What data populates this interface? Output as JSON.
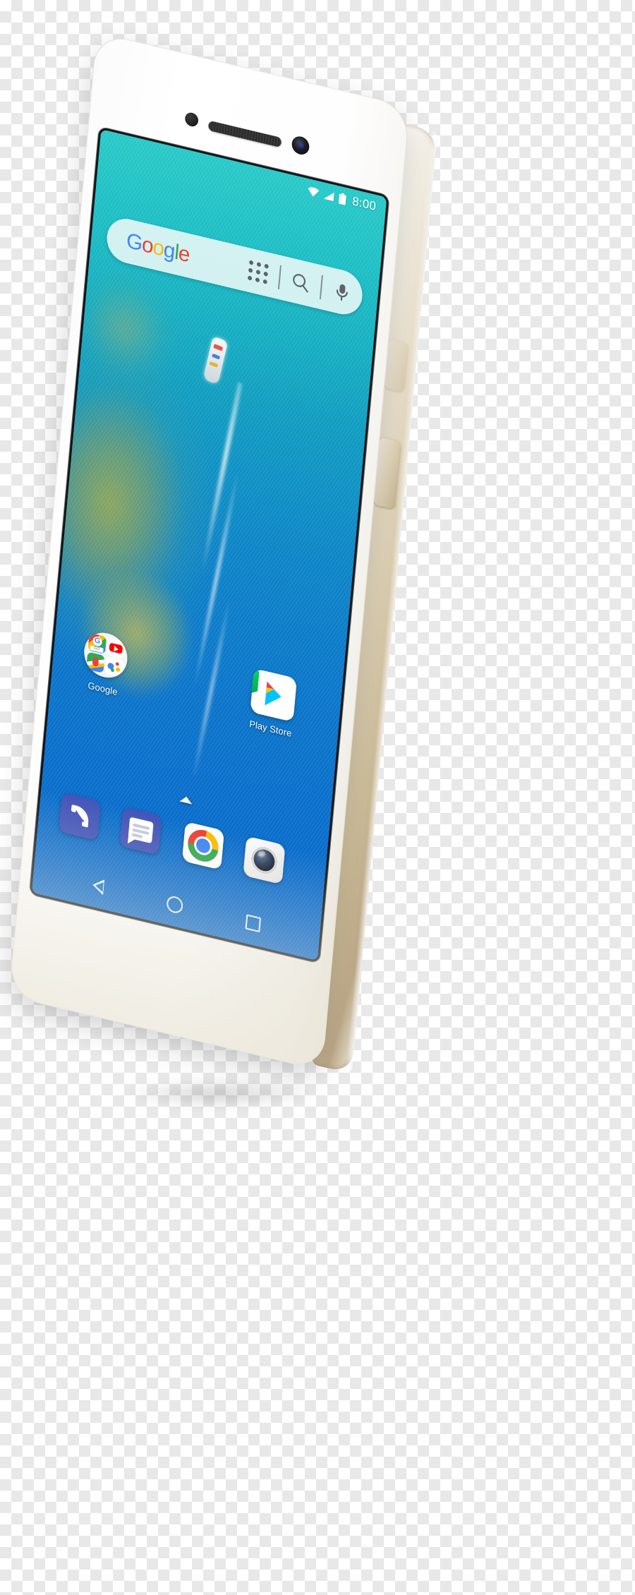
{
  "scene": {
    "subject": "smartphone-product-photo",
    "device_color": "#efe8da",
    "device_accent": "#d9cbad"
  },
  "status_bar": {
    "time": "8:00",
    "icons": [
      "wifi-icon",
      "signal-icon",
      "battery-icon"
    ]
  },
  "search_widget": {
    "logo_letters": [
      "G",
      "o",
      "o",
      "g",
      "l",
      "e"
    ],
    "logo_colors": [
      "#4285F4",
      "#EA4335",
      "#FBBC05",
      "#4285F4",
      "#34A853",
      "#EA4335"
    ],
    "apps_grid_icon": "apps-grid-icon",
    "search_icon": "search-icon",
    "mic_icon": "microphone-icon"
  },
  "home_apps": [
    {
      "label": "Google",
      "icon": "google-folder-icon",
      "folder_items": [
        "google-go-icon",
        "youtube-icon",
        "maps-go-icon",
        "assistant-icon"
      ],
      "folder_item_labels": [
        "GO",
        "",
        "GO",
        ""
      ]
    },
    {
      "label": "Play Store",
      "icon": "play-store-icon"
    }
  ],
  "drawer": {
    "handle": "app-drawer-chevron-icon"
  },
  "dock": [
    {
      "label": "Phone",
      "icon": "phone-icon",
      "color": "#4355B9"
    },
    {
      "label": "Messages",
      "icon": "messages-icon",
      "color": "#4355B9"
    },
    {
      "label": "Chrome",
      "icon": "chrome-icon",
      "color": "#ffffff"
    },
    {
      "label": "Camera",
      "icon": "camera-icon",
      "color": "#f0f0f0"
    }
  ],
  "nav_bar": [
    {
      "name": "back-button",
      "icon": "back-triangle-icon"
    },
    {
      "name": "home-button",
      "icon": "home-circle-icon"
    },
    {
      "name": "recents-button",
      "icon": "recents-square-icon"
    }
  ],
  "hardware": {
    "proximity_sensor": "proximity-sensor",
    "earpiece": "earpiece-speaker",
    "front_camera": "front-camera",
    "power_button": "power-button",
    "volume_button": "volume-button"
  },
  "wallpaper": {
    "name": "aerial-ocean-wallpaper",
    "top_color": "#1fb9b8",
    "bottom_color": "#0a6acd",
    "subject": "boat-with-wake"
  }
}
